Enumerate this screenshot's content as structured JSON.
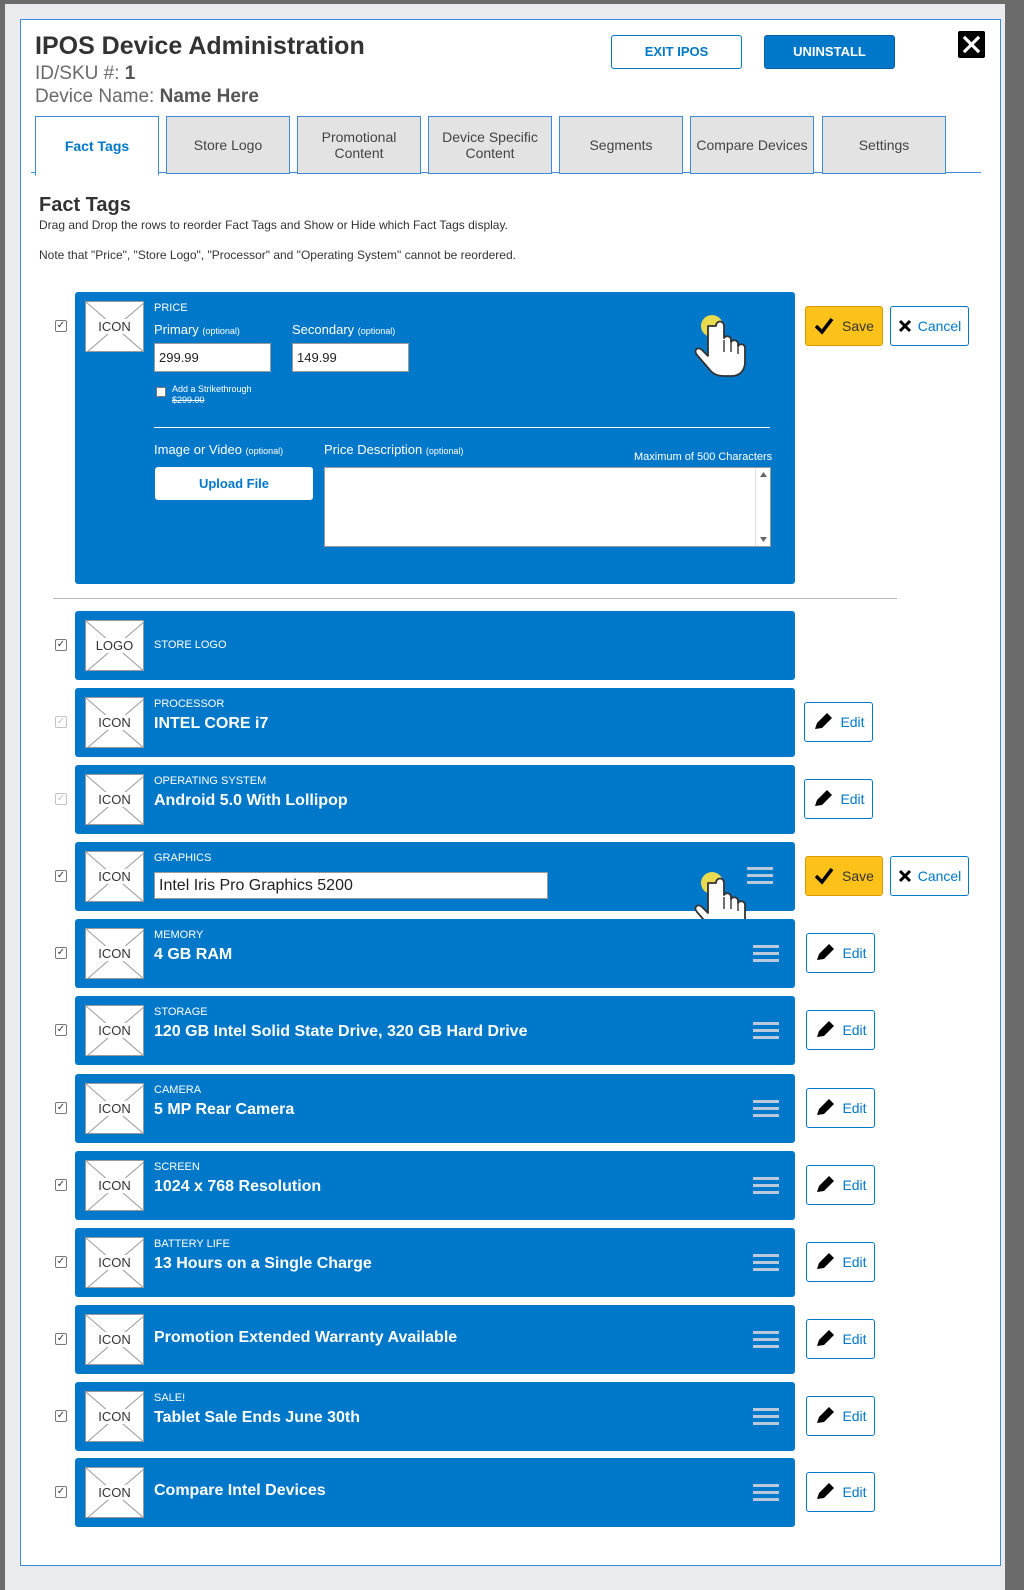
{
  "header": {
    "title": "IPOS Device Administration",
    "sku_label": "ID/SKU #:",
    "sku_value": "1",
    "device_label": "Device Name:",
    "device_value": "Name Here",
    "exit_label": "EXIT IPOS",
    "uninstall_label": "UNINSTALL"
  },
  "tabs": [
    {
      "label": "Fact Tags"
    },
    {
      "label": "Store Logo"
    },
    {
      "label": "Promotional\nContent"
    },
    {
      "label": "Device Specific\nContent"
    },
    {
      "label": "Segments"
    },
    {
      "label": "Compare Devices"
    },
    {
      "label": "Settings"
    }
  ],
  "section": {
    "title": "Fact Tags",
    "instructions": "Drag and Drop the rows to reorder Fact Tags and Show or Hide which Fact Tags display.",
    "note": "Note that \"Price\", \"Store Logo\", \"Processor\" and \"Operating System\" cannot be reordered."
  },
  "price": {
    "label": "PRICE",
    "icon_text": "ICON",
    "primary_label": "Primary",
    "secondary_label": "Secondary",
    "optional": "(optional)",
    "primary_value": "299.99",
    "secondary_value": "149.99",
    "strike_label": "Add a Strikethrough",
    "strike_example": "$299.00",
    "image_label": "Image or Video",
    "upload_label": "Upload File",
    "desc_label": "Price Description",
    "max_chars": "Maximum of 500 Characters"
  },
  "buttons": {
    "save": "Save",
    "cancel": "Cancel",
    "edit": "Edit"
  },
  "store_logo": {
    "label": "STORE LOGO",
    "icon_text": "LOGO"
  },
  "rows": [
    {
      "label": "PROCESSOR",
      "value": "INTEL CORE i7",
      "icon_text": "ICON"
    },
    {
      "label": "OPERATING SYSTEM",
      "value": "Android 5.0 With Lollipop",
      "icon_text": "ICON"
    },
    {
      "label": "GRAPHICS",
      "value": "Intel Iris Pro Graphics 5200",
      "icon_text": "ICON"
    },
    {
      "label": "MEMORY",
      "value": "4 GB RAM",
      "icon_text": "ICON"
    },
    {
      "label": "STORAGE",
      "value": "120 GB Intel Solid State Drive, 320 GB Hard Drive",
      "icon_text": "ICON"
    },
    {
      "label": "CAMERA",
      "value": "5 MP Rear Camera",
      "icon_text": "ICON"
    },
    {
      "label": "SCREEN",
      "value": "1024 x 768 Resolution",
      "icon_text": "ICON"
    },
    {
      "label": "BATTERY LIFE",
      "value": "13 Hours on a Single Charge",
      "icon_text": "ICON"
    },
    {
      "label": "",
      "value": "Promotion Extended Warranty Available",
      "icon_text": "ICON"
    },
    {
      "label": "SALE!",
      "value": "Tablet Sale Ends June 30th",
      "icon_text": "ICON"
    },
    {
      "label": "",
      "value": "Compare Intel Devices",
      "icon_text": "ICON"
    }
  ],
  "colors": {
    "primary_blue": "#0078c9",
    "save_yellow": "#fcc21a",
    "cursor_yellow": "#f5e04a"
  }
}
